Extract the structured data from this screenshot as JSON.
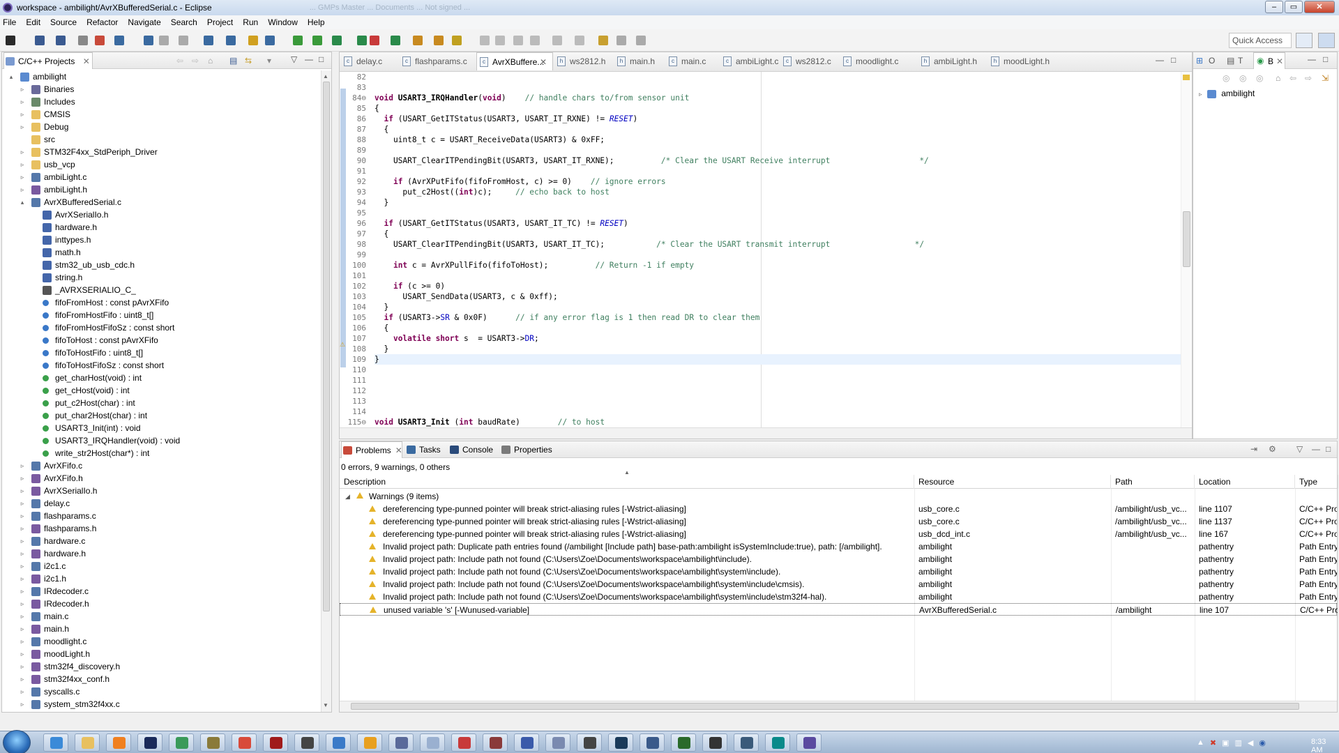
{
  "window": {
    "title": "workspace - ambilight/AvrXBufferedSerial.c - Eclipse",
    "ghost_text": "... GMPs Master ... Documents ... Not signed ...",
    "buttons": [
      "–",
      "▭",
      "✕"
    ]
  },
  "menu": [
    "File",
    "Edit",
    "Source",
    "Refactor",
    "Navigate",
    "Search",
    "Project",
    "Run",
    "Window",
    "Help"
  ],
  "quick_access": "Quick Access",
  "project_explorer": {
    "tab": "C/C++ Projects",
    "items": [
      {
        "label": "ambilight",
        "level": 0,
        "twisty": "▴",
        "icon": "project-icon",
        "color": "#5a8ad0"
      },
      {
        "label": "Binaries",
        "level": 1,
        "twisty": "▹",
        "icon": "binaries-icon",
        "color": "#6a6a9a"
      },
      {
        "label": "Includes",
        "level": 1,
        "twisty": "▹",
        "icon": "includes-icon",
        "color": "#6a8a6a"
      },
      {
        "label": "CMSIS",
        "level": 1,
        "twisty": "▹",
        "icon": "folder-icon",
        "color": "#e8c060"
      },
      {
        "label": "Debug",
        "level": 1,
        "twisty": "▹",
        "icon": "folder-icon",
        "color": "#e8c060"
      },
      {
        "label": "src",
        "level": 1,
        "twisty": "",
        "icon": "folder-icon",
        "color": "#e8c060"
      },
      {
        "label": "STM32F4xx_StdPeriph_Driver",
        "level": 1,
        "twisty": "▹",
        "icon": "folder-icon",
        "color": "#e8c060"
      },
      {
        "label": "usb_vcp",
        "level": 1,
        "twisty": "▹",
        "icon": "folder-icon",
        "color": "#e8c060"
      },
      {
        "label": "ambiLight.c",
        "level": 1,
        "twisty": "▹",
        "icon": "c-file-icon",
        "color": "#5578aa"
      },
      {
        "label": "ambiLight.h",
        "level": 1,
        "twisty": "▹",
        "icon": "h-file-icon",
        "color": "#7a5aa0"
      },
      {
        "label": "AvrXBufferedSerial.c",
        "level": 1,
        "twisty": "▴",
        "icon": "c-file-icon",
        "color": "#5578aa"
      },
      {
        "label": "AvrXSerialIo.h",
        "level": 2,
        "twisty": "",
        "icon": "include-icon",
        "color": "#4466aa"
      },
      {
        "label": "hardware.h",
        "level": 2,
        "twisty": "",
        "icon": "include-icon",
        "color": "#4466aa"
      },
      {
        "label": "inttypes.h",
        "level": 2,
        "twisty": "",
        "icon": "include-icon",
        "color": "#4466aa"
      },
      {
        "label": "math.h",
        "level": 2,
        "twisty": "",
        "icon": "include-icon",
        "color": "#4466aa"
      },
      {
        "label": "stm32_ub_usb_cdc.h",
        "level": 2,
        "twisty": "",
        "icon": "include-icon",
        "color": "#4466aa"
      },
      {
        "label": "string.h",
        "level": 2,
        "twisty": "",
        "icon": "include-icon",
        "color": "#4466aa"
      },
      {
        "label": "_AVRXSERIALIO_C_",
        "level": 2,
        "twisty": "",
        "icon": "macro-icon",
        "color": "#555555"
      },
      {
        "label": "fifoFromHost : const pAvrXFifo",
        "level": 2,
        "twisty": "",
        "icon": "variable-icon",
        "color": "#3a78c8"
      },
      {
        "label": "fifoFromHostFifo : uint8_t[]",
        "level": 2,
        "twisty": "",
        "icon": "variable-icon",
        "color": "#3a78c8"
      },
      {
        "label": "fifoFromHostFifoSz : const short",
        "level": 2,
        "twisty": "",
        "icon": "static-variable-icon",
        "color": "#3a78c8"
      },
      {
        "label": "fifoToHost : const pAvrXFifo",
        "level": 2,
        "twisty": "",
        "icon": "variable-icon",
        "color": "#3a78c8"
      },
      {
        "label": "fifoToHostFifo : uint8_t[]",
        "level": 2,
        "twisty": "",
        "icon": "variable-icon",
        "color": "#3a78c8"
      },
      {
        "label": "fifoToHostFifoSz : const short",
        "level": 2,
        "twisty": "",
        "icon": "static-variable-icon",
        "color": "#3a78c8"
      },
      {
        "label": "get_charHost(void) : int",
        "level": 2,
        "twisty": "",
        "icon": "function-icon",
        "color": "#3aa04a"
      },
      {
        "label": "get_cHost(void) : int",
        "level": 2,
        "twisty": "",
        "icon": "function-icon",
        "color": "#3aa04a"
      },
      {
        "label": "put_c2Host(char) : int",
        "level": 2,
        "twisty": "",
        "icon": "function-icon",
        "color": "#3aa04a"
      },
      {
        "label": "put_char2Host(char) : int",
        "level": 2,
        "twisty": "",
        "icon": "function-icon",
        "color": "#3aa04a"
      },
      {
        "label": "USART3_Init(int) : void",
        "level": 2,
        "twisty": "",
        "icon": "function-icon",
        "color": "#3aa04a"
      },
      {
        "label": "USART3_IRQHandler(void) : void",
        "level": 2,
        "twisty": "",
        "icon": "function-warning-icon",
        "color": "#3aa04a"
      },
      {
        "label": "write_str2Host(char*) : int",
        "level": 2,
        "twisty": "",
        "icon": "function-icon",
        "color": "#3aa04a"
      },
      {
        "label": "AvrXFifo.c",
        "level": 1,
        "twisty": "▹",
        "icon": "c-file-icon",
        "color": "#5578aa"
      },
      {
        "label": "AvrXFifo.h",
        "level": 1,
        "twisty": "▹",
        "icon": "h-file-icon",
        "color": "#7a5aa0"
      },
      {
        "label": "AvrXSerialIo.h",
        "level": 1,
        "twisty": "▹",
        "icon": "h-file-icon",
        "color": "#7a5aa0"
      },
      {
        "label": "delay.c",
        "level": 1,
        "twisty": "▹",
        "icon": "c-file-icon",
        "color": "#5578aa"
      },
      {
        "label": "flashparams.c",
        "level": 1,
        "twisty": "▹",
        "icon": "c-file-icon",
        "color": "#5578aa"
      },
      {
        "label": "flashparams.h",
        "level": 1,
        "twisty": "▹",
        "icon": "h-file-icon",
        "color": "#7a5aa0"
      },
      {
        "label": "hardware.c",
        "level": 1,
        "twisty": "▹",
        "icon": "c-file-icon",
        "color": "#5578aa"
      },
      {
        "label": "hardware.h",
        "level": 1,
        "twisty": "▹",
        "icon": "h-file-icon",
        "color": "#7a5aa0"
      },
      {
        "label": "i2c1.c",
        "level": 1,
        "twisty": "▹",
        "icon": "c-file-icon",
        "color": "#5578aa"
      },
      {
        "label": "i2c1.h",
        "level": 1,
        "twisty": "▹",
        "icon": "h-file-icon",
        "color": "#7a5aa0"
      },
      {
        "label": "IRdecoder.c",
        "level": 1,
        "twisty": "▹",
        "icon": "c-file-icon",
        "color": "#5578aa"
      },
      {
        "label": "IRdecoder.h",
        "level": 1,
        "twisty": "▹",
        "icon": "h-file-icon",
        "color": "#7a5aa0"
      },
      {
        "label": "main.c",
        "level": 1,
        "twisty": "▹",
        "icon": "c-file-icon",
        "color": "#5578aa"
      },
      {
        "label": "main.h",
        "level": 1,
        "twisty": "▹",
        "icon": "h-file-icon",
        "color": "#7a5aa0"
      },
      {
        "label": "moodlight.c",
        "level": 1,
        "twisty": "▹",
        "icon": "c-file-icon",
        "color": "#5578aa"
      },
      {
        "label": "moodLight.h",
        "level": 1,
        "twisty": "▹",
        "icon": "h-file-icon",
        "color": "#7a5aa0"
      },
      {
        "label": "stm32f4_discovery.h",
        "level": 1,
        "twisty": "▹",
        "icon": "h-file-icon",
        "color": "#7a5aa0"
      },
      {
        "label": "stm32f4xx_conf.h",
        "level": 1,
        "twisty": "▹",
        "icon": "h-file-icon",
        "color": "#7a5aa0"
      },
      {
        "label": "syscalls.c",
        "level": 1,
        "twisty": "▹",
        "icon": "c-file-icon",
        "color": "#5578aa"
      },
      {
        "label": "system_stm32f4xx.c",
        "level": 1,
        "twisty": "▹",
        "icon": "c-file-icon",
        "color": "#5578aa"
      }
    ]
  },
  "editor": {
    "tabs": [
      "delay.c",
      "flashparams.c",
      "AvrXBuffere...",
      "ws2812.h",
      "main.h",
      "main.c",
      "ambiLight.c",
      "ws2812.c",
      "moodlight.c",
      "ambiLight.h",
      "moodLight.h"
    ],
    "active_tab": "AvrXBuffere...",
    "close_glyph": "✕",
    "lines": [
      {
        "n": "82",
        "code": []
      },
      {
        "n": "83",
        "code": []
      },
      {
        "n": "84⊖",
        "code": [
          [
            "kw",
            "void "
          ],
          [
            "b",
            "USART3_IRQHandler"
          ],
          [
            "",
            "("
          ],
          [
            "kw",
            "void"
          ],
          [
            "",
            ")    "
          ],
          [
            "cm",
            "// handle chars to/from sensor unit"
          ]
        ]
      },
      {
        "n": "85",
        "code": [
          [
            "",
            "{"
          ]
        ]
      },
      {
        "n": "86",
        "code": [
          [
            "",
            "  "
          ],
          [
            "kw",
            "if"
          ],
          [
            "",
            " (USART_GetITStatus(USART3, USART_IT_RXNE) != "
          ],
          [
            "mac",
            "RESET"
          ],
          [
            "",
            ")"
          ]
        ]
      },
      {
        "n": "87",
        "code": [
          [
            "",
            "  {"
          ]
        ]
      },
      {
        "n": "88",
        "code": [
          [
            "",
            "    uint8_t c = USART_ReceiveData(USART3) & 0xFF;"
          ]
        ]
      },
      {
        "n": "89",
        "code": []
      },
      {
        "n": "90",
        "code": [
          [
            "",
            "    USART_ClearITPendingBit(USART3, USART_IT_RXNE);          "
          ],
          [
            "cm",
            "/* Clear the USART Receive interrupt                   */"
          ]
        ]
      },
      {
        "n": "91",
        "code": []
      },
      {
        "n": "92",
        "code": [
          [
            "",
            "    "
          ],
          [
            "kw",
            "if"
          ],
          [
            "",
            " (AvrXPutFifo(fifoFromHost, c) >= 0)    "
          ],
          [
            "cm",
            "// ignore errors"
          ]
        ]
      },
      {
        "n": "93",
        "code": [
          [
            "",
            "      put_c2Host(("
          ],
          [
            "kw",
            "int"
          ],
          [
            "",
            ")c);     "
          ],
          [
            "cm",
            "// echo back to host"
          ]
        ]
      },
      {
        "n": "94",
        "code": [
          [
            "",
            "  }"
          ]
        ]
      },
      {
        "n": "95",
        "code": []
      },
      {
        "n": "96",
        "code": [
          [
            "",
            "  "
          ],
          [
            "kw",
            "if"
          ],
          [
            "",
            " (USART_GetITStatus(USART3, USART_IT_TC) != "
          ],
          [
            "mac",
            "RESET"
          ],
          [
            "",
            ")"
          ]
        ]
      },
      {
        "n": "97",
        "code": [
          [
            "",
            "  {"
          ]
        ]
      },
      {
        "n": "98",
        "code": [
          [
            "",
            "    USART_ClearITPendingBit(USART3, USART_IT_TC);           "
          ],
          [
            "cm",
            "/* Clear the USART transmit interrupt                  */"
          ]
        ]
      },
      {
        "n": "99",
        "code": []
      },
      {
        "n": "100",
        "code": [
          [
            "",
            "    "
          ],
          [
            "kw",
            "int"
          ],
          [
            "",
            " c = AvrXPullFifo(fifoToHost);          "
          ],
          [
            "cm",
            "// Return -1 if empty"
          ]
        ]
      },
      {
        "n": "101",
        "code": []
      },
      {
        "n": "102",
        "code": [
          [
            "",
            "    "
          ],
          [
            "kw",
            "if"
          ],
          [
            "",
            " (c >= 0)"
          ]
        ]
      },
      {
        "n": "103",
        "code": [
          [
            "",
            "      USART_SendData(USART3, c & 0xff);"
          ]
        ]
      },
      {
        "n": "104",
        "code": [
          [
            "",
            "  }"
          ]
        ]
      },
      {
        "n": "105",
        "code": [
          [
            "",
            "  "
          ],
          [
            "kw",
            "if"
          ],
          [
            "",
            " (USART3->"
          ],
          [
            "fld",
            "SR"
          ],
          [
            "",
            " & 0x0F)      "
          ],
          [
            "cm",
            "// if any error flag is 1 then read DR to clear them"
          ]
        ]
      },
      {
        "n": "106",
        "code": [
          [
            "",
            "  {"
          ]
        ]
      },
      {
        "n": "107",
        "code": [
          [
            "",
            "    "
          ],
          [
            "kw",
            "volatile short"
          ],
          [
            "",
            " s  = USART3->"
          ],
          [
            "fld",
            "DR"
          ],
          [
            "",
            ";"
          ]
        ]
      },
      {
        "n": "108",
        "code": [
          [
            "",
            "  }"
          ]
        ]
      },
      {
        "n": "109",
        "code": [
          [
            "",
            "}"
          ]
        ]
      },
      {
        "n": "110",
        "code": []
      },
      {
        "n": "111",
        "code": []
      },
      {
        "n": "112",
        "code": []
      },
      {
        "n": "113",
        "code": []
      },
      {
        "n": "114",
        "code": []
      },
      {
        "n": "115⊖",
        "code": [
          [
            "kw",
            "void "
          ],
          [
            "b",
            "USART3_Init"
          ],
          [
            "",
            " ("
          ],
          [
            "kw",
            "int"
          ],
          [
            "",
            " baudRate)        "
          ],
          [
            "cm",
            "// to host"
          ]
        ]
      }
    ]
  },
  "outline": {
    "tabs": [
      "O",
      "T",
      "B"
    ],
    "item": "ambilight"
  },
  "problems": {
    "tabs": [
      "Problems",
      "Tasks",
      "Console",
      "Properties"
    ],
    "summary": "0 errors, 9 warnings, 0 others",
    "columns": [
      "Description",
      "Resource",
      "Path",
      "Location",
      "Type"
    ],
    "group": "Warnings (9 items)",
    "rows": [
      {
        "desc": "dereferencing type-punned pointer will break strict-aliasing rules [-Wstrict-aliasing]",
        "res": "usb_core.c",
        "path": "/ambilight/usb_vc...",
        "loc": "line 1107",
        "type": "C/C++ Pro"
      },
      {
        "desc": "dereferencing type-punned pointer will break strict-aliasing rules [-Wstrict-aliasing]",
        "res": "usb_core.c",
        "path": "/ambilight/usb_vc...",
        "loc": "line 1137",
        "type": "C/C++ Pro"
      },
      {
        "desc": "dereferencing type-punned pointer will break strict-aliasing rules [-Wstrict-aliasing]",
        "res": "usb_dcd_int.c",
        "path": "/ambilight/usb_vc...",
        "loc": "line 167",
        "type": "C/C++ Pro"
      },
      {
        "desc": "Invalid project path: Duplicate path entries found (/ambilight [Include path] base-path:ambilight isSystemInclude:true), path: [/ambilight].",
        "res": "ambilight",
        "path": "",
        "loc": "pathentry",
        "type": "Path Entry"
      },
      {
        "desc": "Invalid project path: Include path not found (C:\\Users\\Zoe\\Documents\\workspace\\ambilight\\include).",
        "res": "ambilight",
        "path": "",
        "loc": "pathentry",
        "type": "Path Entry"
      },
      {
        "desc": "Invalid project path: Include path not found (C:\\Users\\Zoe\\Documents\\workspace\\ambilight\\system\\include).",
        "res": "ambilight",
        "path": "",
        "loc": "pathentry",
        "type": "Path Entry"
      },
      {
        "desc": "Invalid project path: Include path not found (C:\\Users\\Zoe\\Documents\\workspace\\ambilight\\system\\include\\cmsis).",
        "res": "ambilight",
        "path": "",
        "loc": "pathentry",
        "type": "Path Entry"
      },
      {
        "desc": "Invalid project path: Include path not found (C:\\Users\\Zoe\\Documents\\workspace\\ambilight\\system\\include\\stm32f4-hal).",
        "res": "ambilight",
        "path": "",
        "loc": "pathentry",
        "type": "Path Entry"
      },
      {
        "desc": "unused variable 's' [-Wunused-variable]",
        "res": "AvrXBufferedSerial.c",
        "path": "/ambilight",
        "loc": "line 107",
        "type": "C/C++ Pro"
      }
    ]
  },
  "taskbar": {
    "clock": "8:33 AM",
    "apps": [
      {
        "name": "internet-explorer",
        "color": "#3a8ad8"
      },
      {
        "name": "file-explorer",
        "color": "#e8c060"
      },
      {
        "name": "media-player",
        "color": "#f08020"
      },
      {
        "name": "photoshop",
        "color": "#1a2a5a"
      },
      {
        "name": "network-tool",
        "color": "#3a9a5a"
      },
      {
        "name": "app-circle",
        "color": "#8a7a3a"
      },
      {
        "name": "chrome",
        "color": "#d84a3a"
      },
      {
        "name": "acrobat",
        "color": "#a01a1a"
      },
      {
        "name": "console",
        "color": "#444444"
      },
      {
        "name": "globe",
        "color": "#3a7ac8"
      },
      {
        "name": "arduino",
        "color": "#e8a020"
      },
      {
        "name": "settings",
        "color": "#5a6a9a"
      },
      {
        "name": "notepad",
        "color": "#9ab0d0"
      },
      {
        "name": "calculator",
        "color": "#c83a3a"
      },
      {
        "name": "archive",
        "color": "#8a3a3a"
      },
      {
        "name": "remote",
        "color": "#3a5aaa"
      },
      {
        "name": "document",
        "color": "#7a8ab0"
      },
      {
        "name": "inkscape",
        "color": "#444444"
      },
      {
        "name": "steam",
        "color": "#1a3a5a"
      },
      {
        "name": "explorer-window",
        "color": "#3a5a8a"
      },
      {
        "name": "terminal",
        "color": "#2a6a2a"
      },
      {
        "name": "media",
        "color": "#333333"
      },
      {
        "name": "display",
        "color": "#3a5a7a"
      },
      {
        "name": "arduino-ide",
        "color": "#0a8a8a"
      },
      {
        "name": "eclipse",
        "color": "#5a4aa0"
      }
    ]
  }
}
